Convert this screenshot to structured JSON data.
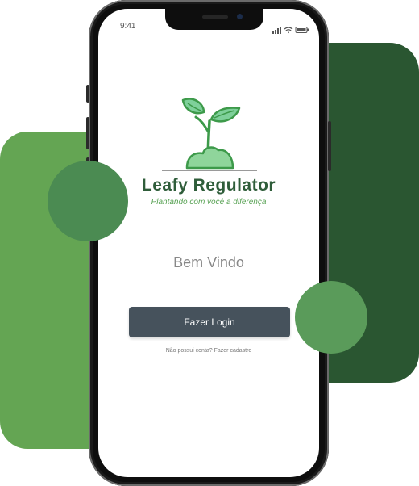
{
  "status_bar": {
    "time": "9:41"
  },
  "brand": {
    "name": "Leafy Regulator",
    "tagline": "Plantando com você a diferença"
  },
  "welcome": {
    "text": "Bem Vindo"
  },
  "actions": {
    "login_label": "Fazer Login",
    "signup_label": "Não possui conta? Fazer cadastro"
  },
  "colors": {
    "brand_dark_green": "#2f5d3a",
    "accent_green": "#5aa356",
    "button_bg": "#46525c",
    "blob_left": "#64a553",
    "blob_right": "#2a5631"
  },
  "icons": [
    "sprout-logo-icon",
    "signal-icon",
    "wifi-icon",
    "battery-icon"
  ]
}
